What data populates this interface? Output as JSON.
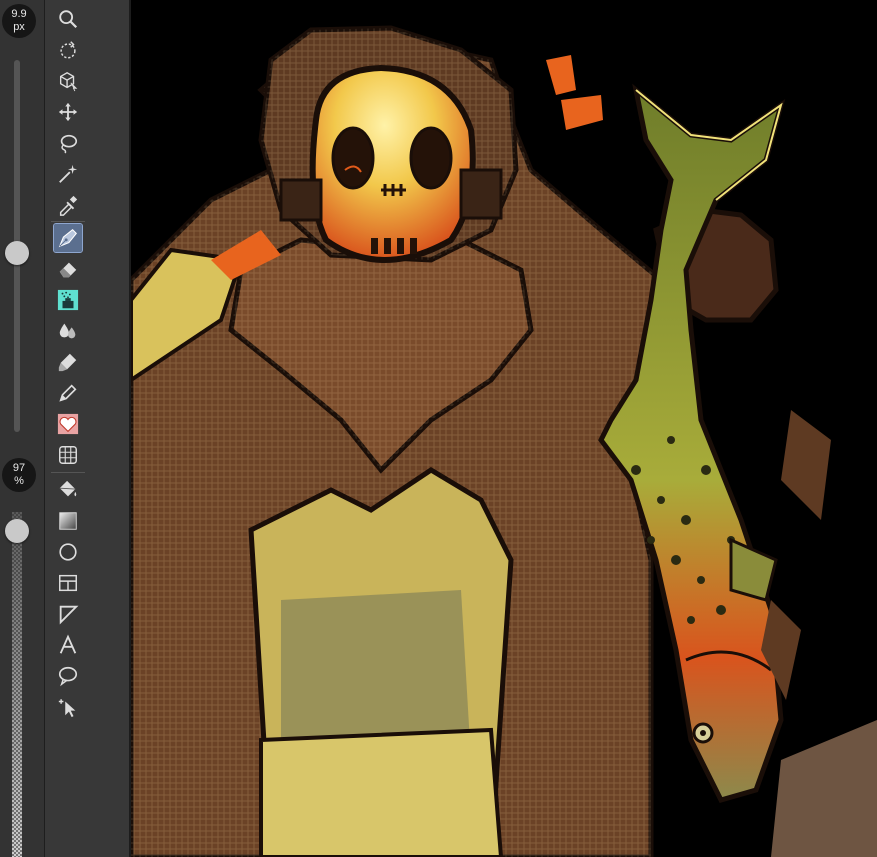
{
  "brush_size": {
    "value": "9.9",
    "unit": "px",
    "level": 0.48
  },
  "opacity": {
    "value": "97",
    "unit": "%",
    "level": 0.97
  },
  "tools": [
    {
      "name": "zoom-tool",
      "icon": "magnifier-icon",
      "active": false
    },
    {
      "name": "rotate-tool",
      "icon": "rotate-dashed-icon",
      "active": false
    },
    {
      "name": "object-tool",
      "icon": "object-cube-icon",
      "active": false
    },
    {
      "name": "move-tool",
      "icon": "move-arrows-icon",
      "active": false
    },
    {
      "name": "lasso-select-tool",
      "icon": "lasso-icon",
      "active": false
    },
    {
      "name": "magic-wand-tool",
      "icon": "magic-wand-icon",
      "active": false
    },
    {
      "name": "eyedropper-tool",
      "icon": "eyedropper-icon",
      "active": false
    },
    {
      "name": "pen-tool",
      "icon": "pen-nib-icon",
      "active": true
    },
    {
      "name": "eraser-tool",
      "icon": "eraser-icon",
      "active": false
    },
    {
      "name": "airbrush-tool",
      "icon": "airbrush-icon",
      "active": false
    },
    {
      "name": "blend-tool",
      "icon": "droplets-icon",
      "active": false
    },
    {
      "name": "brush-tool",
      "icon": "paint-brush-icon",
      "active": false
    },
    {
      "name": "pencil-tool",
      "icon": "pencil-icon",
      "active": false
    },
    {
      "name": "decoration-tool",
      "icon": "heart-pattern-icon",
      "active": false
    },
    {
      "name": "ruler-tool",
      "icon": "grid-ruler-icon",
      "active": false
    },
    {
      "name": "fill-tool",
      "icon": "paint-bucket-icon",
      "active": false
    },
    {
      "name": "gradient-tool",
      "icon": "gradient-icon",
      "active": false
    },
    {
      "name": "shape-tool",
      "icon": "ellipse-icon",
      "active": false
    },
    {
      "name": "frame-tool",
      "icon": "frame-panel-icon",
      "active": false
    },
    {
      "name": "operation-tool",
      "icon": "triangle-ruler-icon",
      "active": false
    },
    {
      "name": "text-tool",
      "icon": "text-a-icon",
      "active": false
    },
    {
      "name": "balloon-tool",
      "icon": "speech-balloon-icon",
      "active": false
    },
    {
      "name": "correct-line-tool",
      "icon": "cursor-select-icon",
      "active": false
    }
  ],
  "colors": {
    "accent": "#5b6f8f",
    "canvas_bg": "#000000",
    "fish_green": "#9aa23a",
    "cloak_brown": "#6b4226",
    "mask_yellow": "#f2c84b"
  }
}
